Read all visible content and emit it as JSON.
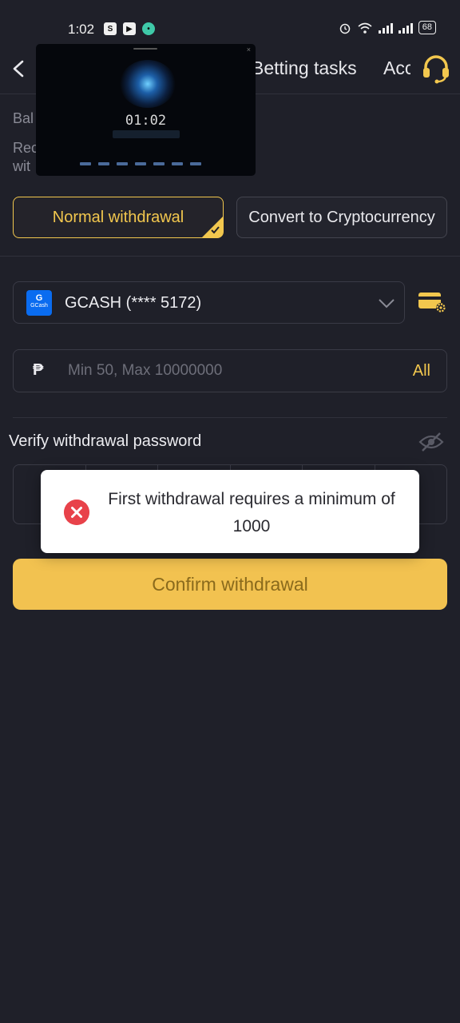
{
  "status_bar": {
    "time": "1:02",
    "battery": "68"
  },
  "header": {
    "tabs": [
      {
        "label": "Betting tasks"
      },
      {
        "label": "Account"
      }
    ]
  },
  "info": {
    "balance_label": "Bal",
    "line1": "Rec",
    "line2": "wit"
  },
  "video_overlay": {
    "timer": "01:02"
  },
  "withdraw_types": [
    {
      "label": "Normal withdrawal",
      "selected": true
    },
    {
      "label": "Convert to Cryptocurrency",
      "selected": false
    }
  ],
  "account": {
    "logo_top": "G",
    "logo_name": "GCash",
    "label": "GCASH (**** 5172)"
  },
  "amount": {
    "currency_symbol": "₱",
    "placeholder": "Min 50, Max 10000000",
    "all_label": "All"
  },
  "password": {
    "label": "Verify withdrawal password",
    "digits": 6
  },
  "confirm": {
    "label": "Confirm withdrawal"
  },
  "toast": {
    "message": "First withdrawal requires a minimum of 1000"
  },
  "colors": {
    "accent": "#f2c74e",
    "background": "#1f2029",
    "error": "#e8424a",
    "gcash": "#0a6cf0"
  }
}
